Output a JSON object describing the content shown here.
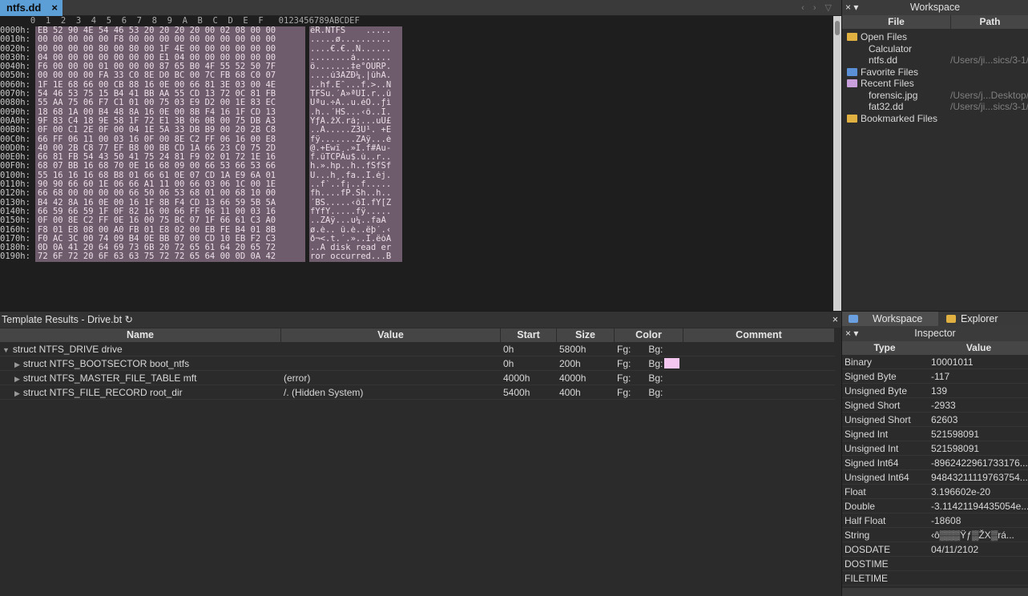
{
  "tab": {
    "file_name": "ntfs.dd",
    "close": "×",
    "nav": "‹ › ▽"
  },
  "hex": {
    "header": "      0  1  2  3  4  5  6  7  8  9  A  B  C  D  E  F   0123456789ABCDEF",
    "rows": [
      {
        "o": "0000h:",
        "b": "EB 52 90 4E 54 46 53 20 20 20 20 00 02 08 00 00",
        "a": "ëR.NTFS    ....."
      },
      {
        "o": "0010h:",
        "b": "00 00 00 00 00 F8 00 00 00 00 00 00 00 00 00 00",
        "a": ".....ø.........."
      },
      {
        "o": "0020h:",
        "b": "00 00 00 00 80 00 80 00 1F 4E 00 00 00 00 00 00",
        "a": "....€.€..N......"
      },
      {
        "o": "0030h:",
        "b": "04 00 00 00 00 00 00 00 E1 04 00 00 00 00 00 00",
        "a": "........á......."
      },
      {
        "o": "0040h:",
        "b": "F6 00 00 00 01 00 00 00 87 65 B0 4F 55 52 50 7F",
        "a": "ö.......‡e°OURP."
      },
      {
        "o": "0050h:",
        "b": "00 00 00 00 FA 33 C0 8E D0 BC 00 7C FB 68 C0 07",
        "a": "....ú3ÀŽÐ¼.|ûhÀ."
      },
      {
        "o": "0060h:",
        "b": "1F 1E 68 66 00 CB 88 16 0E 00 66 81 3E 03 00 4E",
        "a": "..hf.Ëˆ...f.>..N"
      },
      {
        "o": "0070h:",
        "b": "54 46 53 75 15 B4 41 BB AA 55 CD 13 72 0C 81 FB",
        "a": "TFSu.´A»ªUÍ.r..û"
      },
      {
        "o": "0080h:",
        "b": "55 AA 75 06 F7 C1 01 00 75 03 E9 D2 00 1E 83 EC",
        "a": "Uªu.÷Á..u.éÒ..ƒì"
      },
      {
        "o": "0090h:",
        "b": "18 68 1A 00 B4 48 8A 16 0E 00 8B F4 16 1F CD 13",
        "a": ".h..´HŠ...‹ô..Í."
      },
      {
        "o": "00A0h:",
        "b": "9F 83 C4 18 9E 58 1F 72 E1 3B 06 0B 00 75 DB A3",
        "a": "ŸƒÄ.žX.rá;...uÛ£"
      },
      {
        "o": "00B0h:",
        "b": "0F 00 C1 2E 0F 00 04 1E 5A 33 DB B9 00 20 2B C8",
        "a": "..Á.....Z3Û¹. +È"
      },
      {
        "o": "00C0h:",
        "b": "66 FF 06 11 00 03 16 0F 00 8E C2 FF 06 16 00 E8",
        "a": "fÿ.......ŽÂÿ...è"
      },
      {
        "o": "00D0h:",
        "b": "40 00 2B C8 77 EF B8 00 BB CD 1A 66 23 C0 75 2D",
        "a": "@.+Èwï¸.»Í.f#Àu-"
      },
      {
        "o": "00E0h:",
        "b": "66 81 FB 54 43 50 41 75 24 81 F9 02 01 72 1E 16",
        "a": "f.ûTCPAu$.ù..r.."
      },
      {
        "o": "00F0h:",
        "b": "68 07 BB 16 68 70 0E 16 68 09 00 66 53 66 53 66",
        "a": "h.».hp..h..fSfSf"
      },
      {
        "o": "0100h:",
        "b": "55 16 16 16 68 B8 01 66 61 0E 07 CD 1A E9 6A 01",
        "a": "U...h¸.fa..Í.éj."
      },
      {
        "o": "0110h:",
        "b": "90 90 66 60 1E 06 66 A1 11 00 66 03 06 1C 00 1E",
        "a": "..f`..f¡..f....."
      },
      {
        "o": "0120h:",
        "b": "66 68 00 00 00 00 66 50 06 53 68 01 00 68 10 00",
        "a": "fh....fP.Sh..h.."
      },
      {
        "o": "0130h:",
        "b": "B4 42 8A 16 0E 00 16 1F 8B F4 CD 13 66 59 5B 5A",
        "a": "´BŠ.....‹ôÍ.fY[Z"
      },
      {
        "o": "0140h:",
        "b": "66 59 66 59 1F 0F 82 16 00 66 FF 06 11 00 03 16",
        "a": "fYfY.....fÿ....."
      },
      {
        "o": "0150h:",
        "b": "0F 00 8E C2 FF 0E 16 00 75 BC 07 1F 66 61 C3 A0",
        "a": "..ŽÂÿ...u¼..faÃ "
      },
      {
        "o": "0160h:",
        "b": "F8 01 E8 08 00 A0 FB 01 E8 02 00 EB FE B4 01 8B",
        "a": "ø.è.. û.è..ëþ´.‹"
      },
      {
        "o": "0170h:",
        "b": "F0 AC 3C 00 74 09 B4 0E BB 07 00 CD 10 EB F2 C3",
        "a": "ð¬<.t.´.»..Í.ëòÃ"
      },
      {
        "o": "0180h:",
        "b": "0D 0A 41 20 64 69 73 6B 20 72 65 61 64 20 65 72",
        "a": "..A disk read er"
      },
      {
        "o": "0190h:",
        "b": "72 6F 72 20 6F 63 63 75 72 72 65 64 00 0D 0A 42",
        "a": "ror occurred...B"
      }
    ]
  },
  "workspace": {
    "title": "Workspace",
    "controls": "× ▾",
    "col_file": "File",
    "col_path": "Path",
    "nodes": [
      {
        "label": "Open Files",
        "path": "",
        "child": false,
        "folder": "#e0b040"
      },
      {
        "label": "Calculator",
        "path": "",
        "child": true
      },
      {
        "label": "ntfs.dd",
        "path": "/Users/ji...sics/3-1/",
        "child": true
      },
      {
        "label": "Favorite Files",
        "path": "",
        "child": false,
        "folder": "#5b8fd6"
      },
      {
        "label": "Recent Files",
        "path": "",
        "child": false,
        "folder": "#c9a0dc"
      },
      {
        "label": "forensic.jpg",
        "path": "/Users/j...Desktop/",
        "child": true
      },
      {
        "label": "fat32.dd",
        "path": "/Users/ji...sics/3-1/",
        "child": true
      },
      {
        "label": "Bookmarked Files",
        "path": "",
        "child": false,
        "folder": "#e0b040"
      }
    ]
  },
  "template": {
    "title": "Template Results - Drive.bt",
    "refresh": "↻",
    "close": "×",
    "headers": {
      "name": "Name",
      "value": "Value",
      "start": "Start",
      "size": "Size",
      "color": "Color",
      "comment": "Comment"
    },
    "rows": [
      {
        "name": "struct NTFS_DRIVE drive",
        "value": "",
        "start": "0h",
        "size": "5800h",
        "fg": "Fg:",
        "bg": "Bg:",
        "swatch": "",
        "expanded": true,
        "indent": false
      },
      {
        "name": "struct NTFS_BOOTSECTOR boot_ntfs",
        "value": "",
        "start": "0h",
        "size": "200h",
        "fg": "Fg:",
        "bg": "Bg:",
        "swatch": "#f4c6f0",
        "expanded": false,
        "indent": true
      },
      {
        "name": "struct NTFS_MASTER_FILE_TABLE mft",
        "value": "(error)",
        "start": "4000h",
        "size": "4000h",
        "fg": "Fg:",
        "bg": "Bg:",
        "swatch": "",
        "expanded": false,
        "indent": true
      },
      {
        "name": "struct NTFS_FILE_RECORD root_dir",
        "value": "/. (Hidden System)",
        "start": "5400h",
        "size": "400h",
        "fg": "Fg:",
        "bg": "Bg:",
        "swatch": "",
        "expanded": false,
        "indent": true
      }
    ]
  },
  "inspector": {
    "tabs": {
      "workspace": "Workspace",
      "explorer": "Explorer"
    },
    "title": "Inspector",
    "controls": "× ▾",
    "col_type": "Type",
    "col_value": "Value",
    "rows": [
      {
        "k": "Binary",
        "v": "10001011"
      },
      {
        "k": "Signed Byte",
        "v": "-117"
      },
      {
        "k": "Unsigned Byte",
        "v": "139"
      },
      {
        "k": "Signed Short",
        "v": "-2933"
      },
      {
        "k": "Unsigned Short",
        "v": "62603"
      },
      {
        "k": "Signed Int",
        "v": "521598091"
      },
      {
        "k": "Unsigned Int",
        "v": "521598091"
      },
      {
        "k": "Signed Int64",
        "v": "-8962422961733176..."
      },
      {
        "k": "Unsigned Int64",
        "v": "94843211119763754..."
      },
      {
        "k": "Float",
        "v": "3.196602e-20"
      },
      {
        "k": "Double",
        "v": "-3.11421194435054e..."
      },
      {
        "k": "Half Float",
        "v": "-18608"
      },
      {
        "k": "String",
        "v": "‹ô▒▒▒Ÿƒ▒ŽX▒rá..."
      },
      {
        "k": "DOSDATE",
        "v": "04/11/2102"
      },
      {
        "k": "DOSTIME",
        "v": ""
      },
      {
        "k": "FILETIME",
        "v": ""
      }
    ]
  }
}
